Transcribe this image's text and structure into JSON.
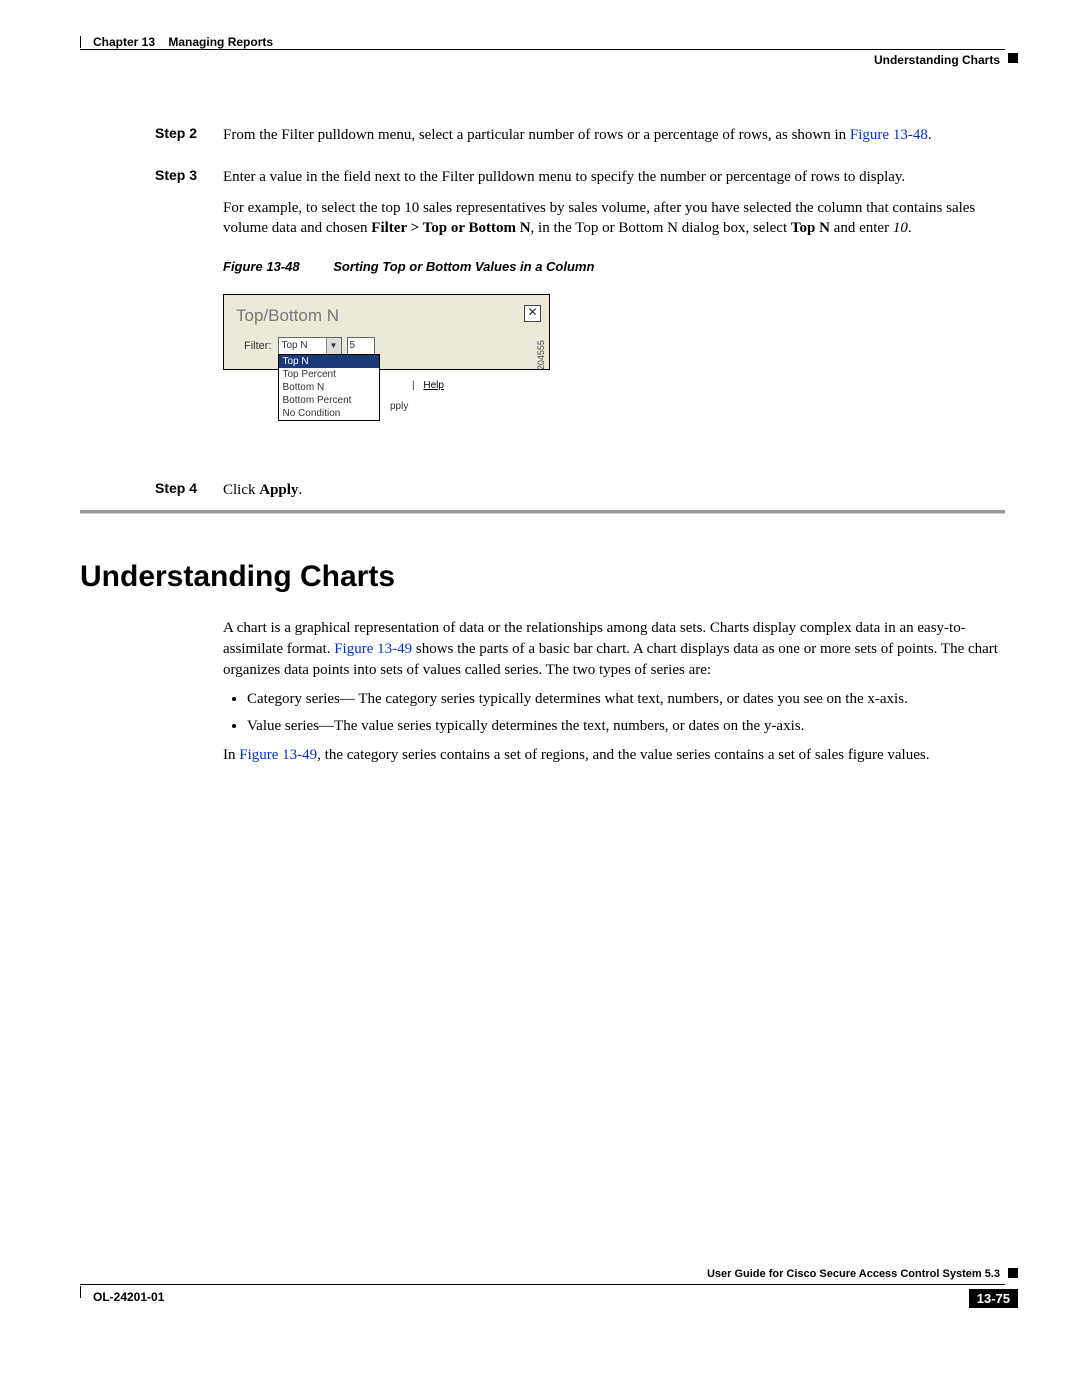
{
  "header": {
    "chapter": "Chapter 13",
    "title": "Managing Reports",
    "section": "Understanding Charts"
  },
  "steps": {
    "s2": {
      "label": "Step 2",
      "text_a": "From the Filter pulldown menu, select a particular number of rows or a percentage of rows, as shown in ",
      "figref": "Figure 13-48",
      "text_b": "."
    },
    "s3": {
      "label": "Step 3",
      "p1": "Enter a value in the field next to the Filter pulldown menu to specify the number or percentage of rows to display.",
      "p2_a": "For example, to select the top 10 sales representatives by sales volume, after you have selected the column that contains sales volume data and chosen ",
      "p2_b": "Filter > Top or Bottom N",
      "p2_c": ", in the Top or Bottom N dialog box, select ",
      "p2_d": "Top N",
      "p2_e": " and enter ",
      "p2_f": "10",
      "p2_g": "."
    },
    "s4": {
      "label": "Step 4",
      "text_a": "Click ",
      "text_b": "Apply",
      "text_c": "."
    }
  },
  "figure": {
    "num": "Figure 13-48",
    "title": "Sorting Top or Bottom Values in a Column",
    "image_id": "204555"
  },
  "dialog": {
    "title": "Top/Bottom N",
    "close": "✕",
    "filter_label": "Filter:",
    "selected": "Top N",
    "value": "5",
    "arrow": "▼",
    "options": {
      "o0": "Top N",
      "o1": "Top Percent",
      "o2": "Bottom N",
      "o3": "Bottom Percent",
      "o4": "No Condition"
    },
    "help_bar": "|",
    "help": "Help",
    "apply_frag": "pply",
    "cancel_frag": ""
  },
  "section": {
    "heading": "Understanding Charts",
    "p1_a": "A chart is a graphical representation of data or the relationships among data sets. Charts display complex data in an easy-to-assimilate format. ",
    "figref": "Figure 13-49",
    "p1_b": " shows the parts of a basic bar chart. A chart displays data as one or more sets of points. The chart organizes data points into sets of values called series. The two types of series are:",
    "li1": "Category series— The category series typically determines what text, numbers, or dates you see on the x-axis.",
    "li2": "Value series—The value series typically determines the text, numbers, or dates on the y-axis.",
    "p2_a": "In ",
    "p2_b": ", the category series contains a set of regions, and the value series contains a set of sales figure values."
  },
  "footer": {
    "doc": "User Guide for Cisco Secure Access Control System 5.3",
    "ol": "OL-24201-01",
    "page": "13-75"
  }
}
